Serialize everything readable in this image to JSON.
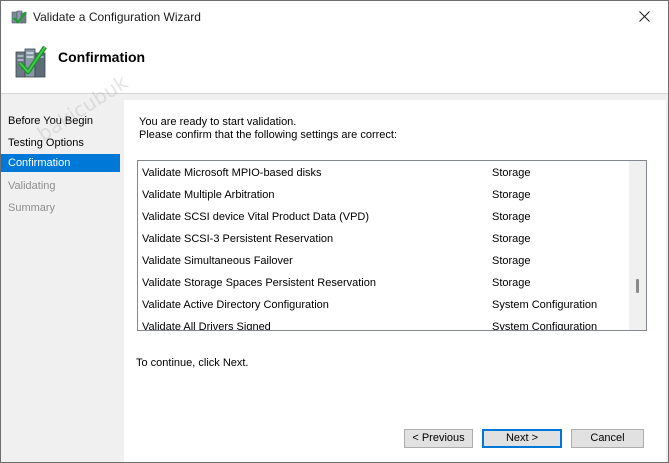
{
  "window": {
    "title": "Validate a Configuration Wizard",
    "close_symbol": "✕"
  },
  "header": {
    "title": "Confirmation",
    "icon": "validation-checkmark-icon"
  },
  "nav": {
    "items": [
      {
        "label": "Before You Begin",
        "state": "normal"
      },
      {
        "label": "Testing Options",
        "state": "normal"
      },
      {
        "label": "Confirmation",
        "state": "selected"
      },
      {
        "label": "Validating",
        "state": "disabled"
      },
      {
        "label": "Summary",
        "state": "disabled"
      }
    ]
  },
  "main": {
    "intro_line1": "You are ready to start validation.",
    "intro_line2": "Please confirm that the following settings are correct:",
    "continue_text": "To continue, click Next."
  },
  "tests": [
    {
      "name": "Validate Microsoft MPIO-based disks",
      "category": "Storage"
    },
    {
      "name": "Validate Multiple Arbitration",
      "category": "Storage"
    },
    {
      "name": "Validate SCSI device Vital Product Data (VPD)",
      "category": "Storage"
    },
    {
      "name": "Validate SCSI-3 Persistent Reservation",
      "category": "Storage"
    },
    {
      "name": "Validate Simultaneous Failover",
      "category": "Storage"
    },
    {
      "name": "Validate Storage Spaces Persistent Reservation",
      "category": "Storage"
    },
    {
      "name": "Validate Active Directory Configuration",
      "category": "System Configuration"
    },
    {
      "name": "Validate All Drivers Signed",
      "category": "System Configuration"
    }
  ],
  "buttons": {
    "previous": "< Previous",
    "next": "Next >",
    "cancel": "Cancel"
  },
  "watermark": "bakicubuk",
  "colors": {
    "selection": "#0078d7",
    "panel": "#f0f0f0"
  }
}
